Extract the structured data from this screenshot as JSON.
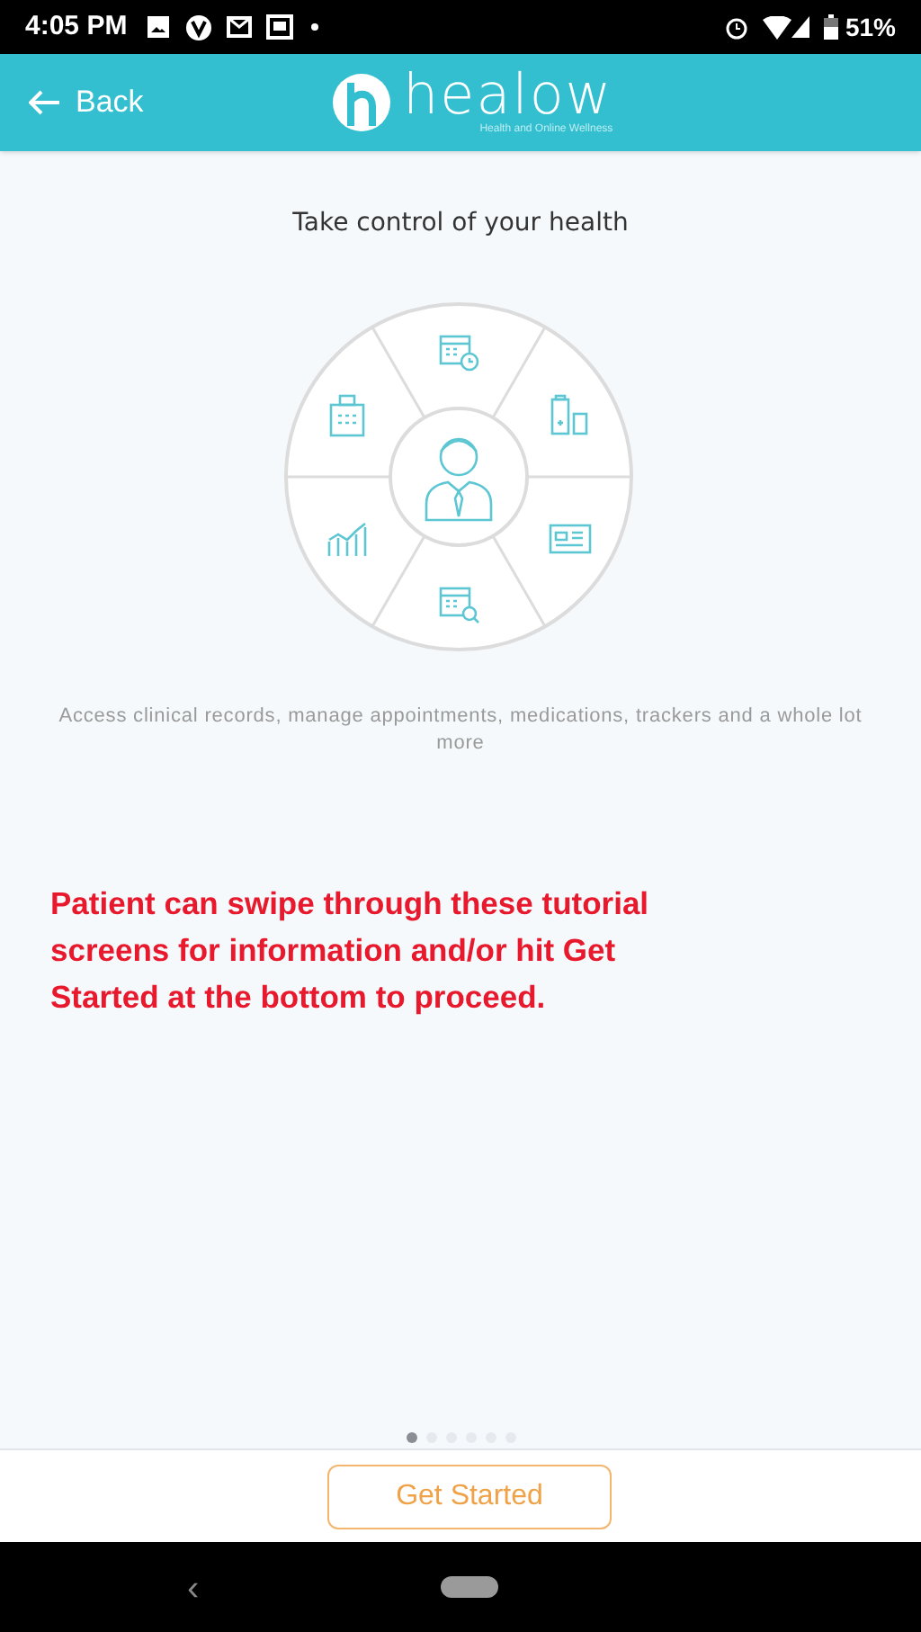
{
  "status_bar": {
    "time": "4:05 PM",
    "battery": "51%"
  },
  "header": {
    "back_label": "Back",
    "logo_text": "healow",
    "logo_tagline": "Health and Online Wellness"
  },
  "slide": {
    "title": "Take control of your health",
    "description": "Access clinical records, manage appointments, medications, trackers and a whole lot more"
  },
  "annotation": "Patient can swipe through these tutorial screens for information and/or hit Get Started at the bottom to proceed.",
  "pages": [
    {
      "selected": true
    },
    {
      "selected": false
    },
    {
      "selected": false
    },
    {
      "selected": false
    },
    {
      "selected": false
    },
    {
      "selected": false
    }
  ],
  "footer": {
    "button": "Get Started"
  },
  "nav_bar": {
    "back": "‹"
  }
}
